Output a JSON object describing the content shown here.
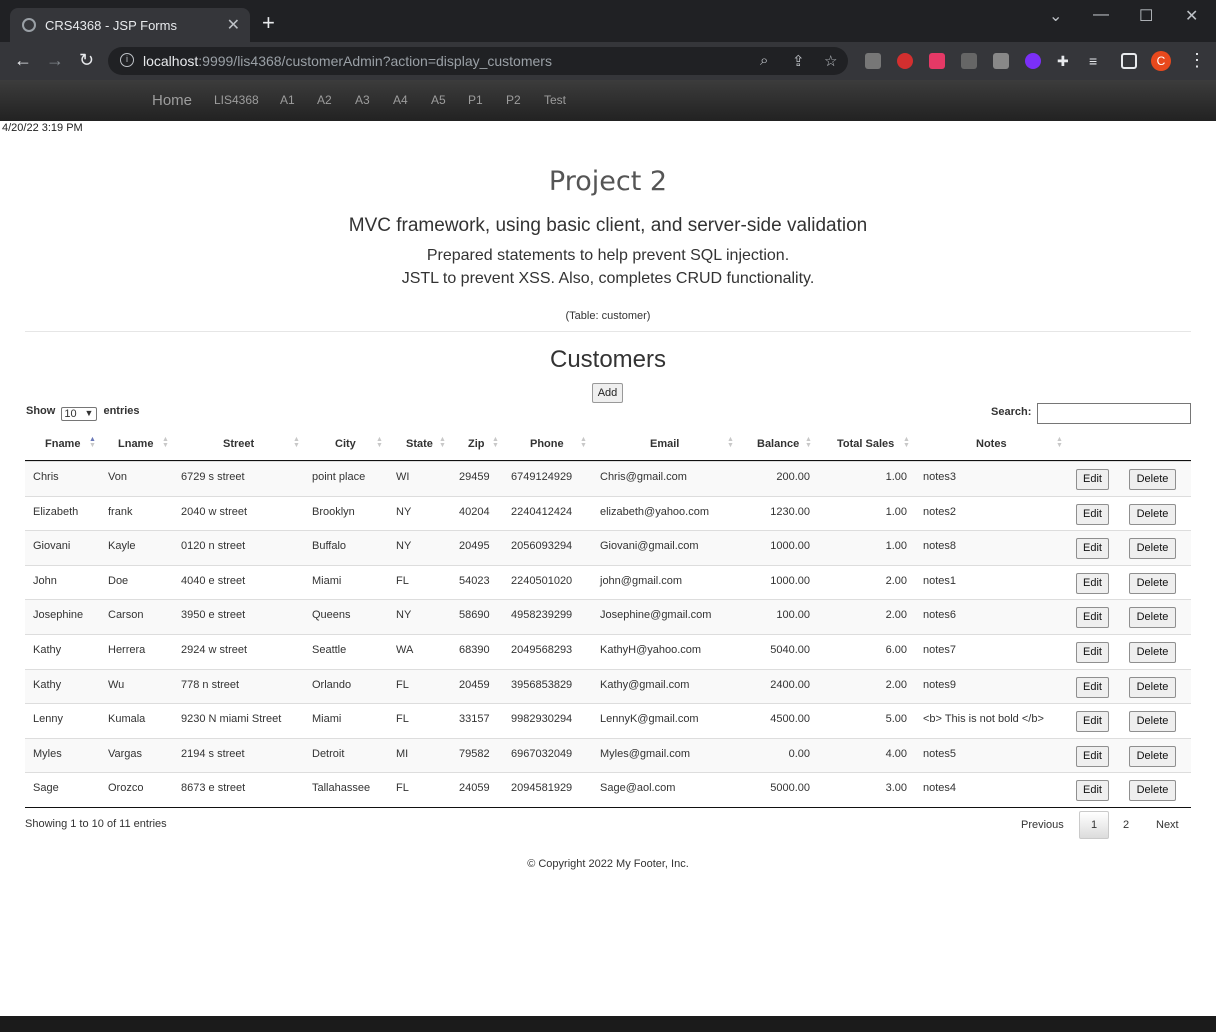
{
  "browser": {
    "tab_title": "CRS4368 - JSP Forms",
    "url_host": "localhost",
    "url_rest": ":9999/lis4368/customerAdmin?action=display_customers",
    "profile_initial": "C",
    "new_tab": "+",
    "tab_close": "✕"
  },
  "nav": {
    "home": "Home",
    "items": [
      "LIS4368",
      "A1",
      "A2",
      "A3",
      "A4",
      "A5",
      "P1",
      "P2",
      "Test"
    ]
  },
  "datestamp": "4/20/22 3:19 PM",
  "header": {
    "title": "Project 2",
    "subtitle": "MVC framework, using basic client, and server-side validation",
    "line1": "Prepared statements to help prevent SQL injection.",
    "line2": "JSTL to prevent XSS. Also, completes CRUD functionality.",
    "table_note": "(Table: customer)"
  },
  "customers": {
    "heading": "Customers",
    "add_label": "Add",
    "show_label": "Show",
    "entries_label": "entries",
    "page_size": "10",
    "search_label": "Search:",
    "columns": [
      "Fname",
      "Lname",
      "Street",
      "City",
      "State",
      "Zip",
      "Phone",
      "Email",
      "Balance",
      "Total Sales",
      "Notes"
    ],
    "edit_label": "Edit",
    "delete_label": "Delete",
    "rows": [
      [
        "Chris",
        "Von",
        "6729 s street",
        "point place",
        "WI",
        "29459",
        "6749124929",
        "Chris@gmail.com",
        "200.00",
        "1.00",
        "notes3"
      ],
      [
        "Elizabeth",
        "frank",
        "2040 w street",
        "Brooklyn",
        "NY",
        "40204",
        "2240412424",
        "elizabeth@yahoo.com",
        "1230.00",
        "1.00",
        "notes2"
      ],
      [
        "Giovani",
        "Kayle",
        "0120 n street",
        "Buffalo",
        "NY",
        "20495",
        "2056093294",
        "Giovani@gmail.com",
        "1000.00",
        "1.00",
        "notes8"
      ],
      [
        "John",
        "Doe",
        "4040 e street",
        "Miami",
        "FL",
        "54023",
        "2240501020",
        "john@gmail.com",
        "1000.00",
        "2.00",
        "notes1"
      ],
      [
        "Josephine",
        "Carson",
        "3950 e street",
        "Queens",
        "NY",
        "58690",
        "4958239299",
        "Josephine@gmail.com",
        "100.00",
        "2.00",
        "notes6"
      ],
      [
        "Kathy",
        "Herrera",
        "2924 w street",
        "Seattle",
        "WA",
        "68390",
        "2049568293",
        "KathyH@yahoo.com",
        "5040.00",
        "6.00",
        "notes7"
      ],
      [
        "Kathy",
        "Wu",
        "778 n street",
        "Orlando",
        "FL",
        "20459",
        "3956853829",
        "Kathy@gmail.com",
        "2400.00",
        "2.00",
        "notes9"
      ],
      [
        "Lenny",
        "Kumala",
        "9230 N miami Street",
        "Miami",
        "FL",
        "33157",
        "9982930294",
        "LennyK@gmail.com",
        "4500.00",
        "5.00",
        "<b> This is not bold </b>"
      ],
      [
        "Myles",
        "Vargas",
        "2194 s street",
        "Detroit",
        "MI",
        "79582",
        "6967032049",
        "Myles@gmail.com",
        "0.00",
        "4.00",
        "notes5"
      ],
      [
        "Sage",
        "Orozco",
        "8673 e street",
        "Tallahassee",
        "FL",
        "24059",
        "2094581929",
        "Sage@aol.com",
        "5000.00",
        "3.00",
        "notes4"
      ]
    ],
    "info": "Showing 1 to 10 of 11 entries",
    "pager": {
      "previous": "Previous",
      "current": "1",
      "page2": "2",
      "next": "Next"
    }
  },
  "footer": "© Copyright 2022 My Footer, Inc."
}
